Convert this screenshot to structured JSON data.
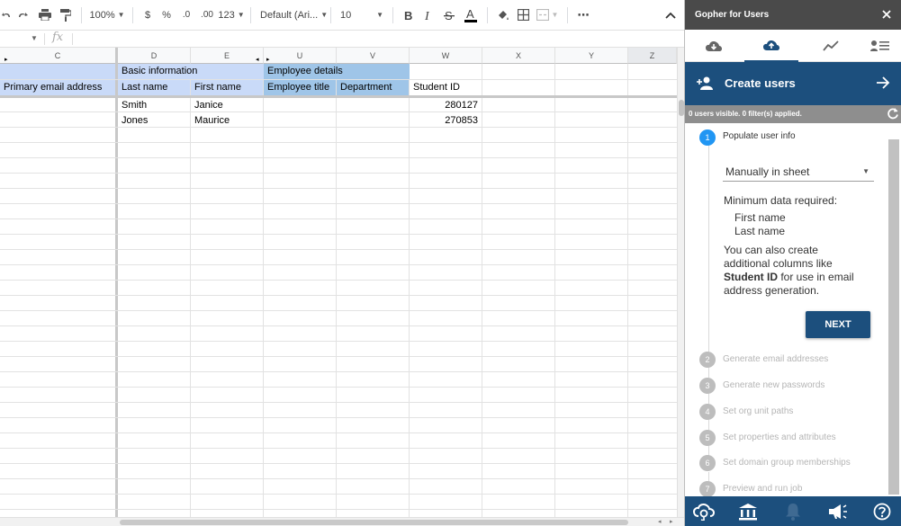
{
  "toolbar": {
    "zoom": "100%",
    "currency": "$",
    "percent": "%",
    "decrease_decimals": ".0",
    "increase_decimals": ".00",
    "number_format": "123",
    "font_family": "Default (Ari...",
    "font_size": "10",
    "more": "⋯"
  },
  "formula_bar": {
    "fx": "fx"
  },
  "columns": [
    {
      "id": "C",
      "label": "C"
    },
    {
      "id": "D",
      "label": "D"
    },
    {
      "id": "E",
      "label": "E"
    },
    {
      "id": "U",
      "label": "U"
    },
    {
      "id": "V",
      "label": "V"
    },
    {
      "id": "W",
      "label": "W"
    },
    {
      "id": "X",
      "label": "X"
    },
    {
      "id": "Y",
      "label": "Y"
    },
    {
      "id": "Z",
      "label": "Z"
    }
  ],
  "sheet": {
    "group_header_basic": "Basic information",
    "group_header_employee": "Employee details",
    "headers": {
      "primary_email": "Primary email address",
      "last_name": "Last name",
      "first_name": "First name",
      "employee_title": "Employee title",
      "department": "Department",
      "student_id": "Student ID"
    },
    "rows": [
      {
        "last_name": "Smith",
        "first_name": "Janice",
        "student_id": "280127"
      },
      {
        "last_name": "Jones",
        "first_name": "Maurice",
        "student_id": "270853"
      }
    ]
  },
  "panel": {
    "title": "Gopher for Users",
    "banner_title": "Create users",
    "status": "0 users visible.  0 filter(s) applied.",
    "steps": [
      {
        "num": "1",
        "label": "Populate user info",
        "active": true
      },
      {
        "num": "2",
        "label": "Generate email addresses",
        "active": false
      },
      {
        "num": "3",
        "label": "Generate new passwords",
        "active": false
      },
      {
        "num": "4",
        "label": "Set org unit paths",
        "active": false
      },
      {
        "num": "5",
        "label": "Set properties and attributes",
        "active": false
      },
      {
        "num": "6",
        "label": "Set domain group memberships",
        "active": false
      },
      {
        "num": "7",
        "label": "Preview and run job",
        "active": false
      }
    ],
    "source_select": "Manually in sheet",
    "min_required_title": "Minimum data required:",
    "min_required": [
      "First name",
      "Last name"
    ],
    "extra_text_1": "You can also create",
    "extra_text_2": "additional columns like",
    "extra_text_bold": "Student ID",
    "extra_text_3": " for use in email",
    "extra_text_4": "address generation.",
    "next_button": "NEXT"
  },
  "colors": {
    "primary": "#1c4f7d",
    "header_blue_light": "#c9daf8",
    "header_blue_dark": "#9fc5e8",
    "step_active": "#2196f3"
  }
}
